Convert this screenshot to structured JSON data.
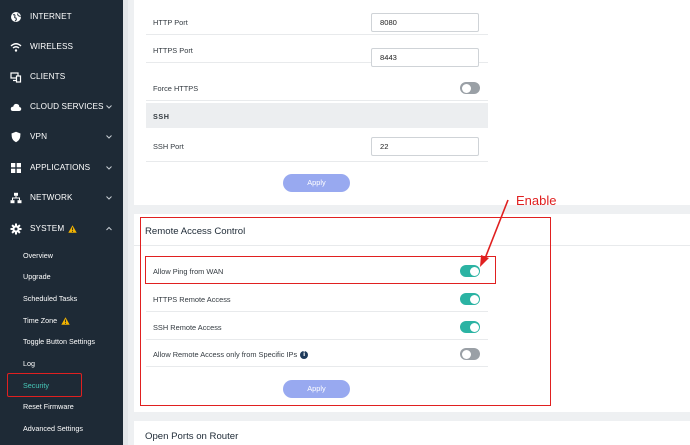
{
  "sidebar": {
    "items": [
      {
        "label": "INTERNET",
        "icon": "globe-icon"
      },
      {
        "label": "WIRELESS",
        "icon": "wifi-icon"
      },
      {
        "label": "CLIENTS",
        "icon": "clients-icon"
      },
      {
        "label": "CLOUD SERVICES",
        "icon": "cloud-icon"
      },
      {
        "label": "VPN",
        "icon": "shield-icon"
      },
      {
        "label": "APPLICATIONS",
        "icon": "apps-grid-icon"
      },
      {
        "label": "NETWORK",
        "icon": "network-icon"
      },
      {
        "label": "SYSTEM",
        "icon": "gear-icon"
      }
    ],
    "system_subitems": [
      {
        "label": "Overview"
      },
      {
        "label": "Upgrade"
      },
      {
        "label": "Scheduled Tasks"
      },
      {
        "label": "Time Zone"
      },
      {
        "label": "Toggle Button Settings"
      },
      {
        "label": "Log"
      },
      {
        "label": "Security"
      },
      {
        "label": "Reset Firmware"
      },
      {
        "label": "Advanced Settings"
      }
    ]
  },
  "ports_card": {
    "http_port": {
      "label": "HTTP Port",
      "value": "8080"
    },
    "https_port": {
      "label": "HTTPS Port",
      "value": "8443"
    },
    "force_https": {
      "label": "Force HTTPS",
      "enabled": false
    },
    "ssh_section": "SSH",
    "ssh_port": {
      "label": "SSH Port",
      "value": "22"
    },
    "apply_label": "Apply"
  },
  "remote_access": {
    "title": "Remote Access Control",
    "rows": [
      {
        "label": "Allow Ping from WAN",
        "enabled": true
      },
      {
        "label": "HTTPS Remote Access",
        "enabled": true
      },
      {
        "label": "SSH Remote Access",
        "enabled": true
      },
      {
        "label": "Allow Remote Access only from Specific IPs",
        "enabled": false
      }
    ],
    "apply_label": "Apply"
  },
  "open_ports": {
    "title": "Open Ports on Router"
  },
  "annotation": {
    "text": "Enable"
  },
  "colors": {
    "sidebar_bg": "#1e2a36",
    "accent_teal": "#2bb3a3",
    "apply_button": "#98a9f0",
    "annotation_red": "#e02020",
    "warning_yellow": "#f4b400"
  }
}
